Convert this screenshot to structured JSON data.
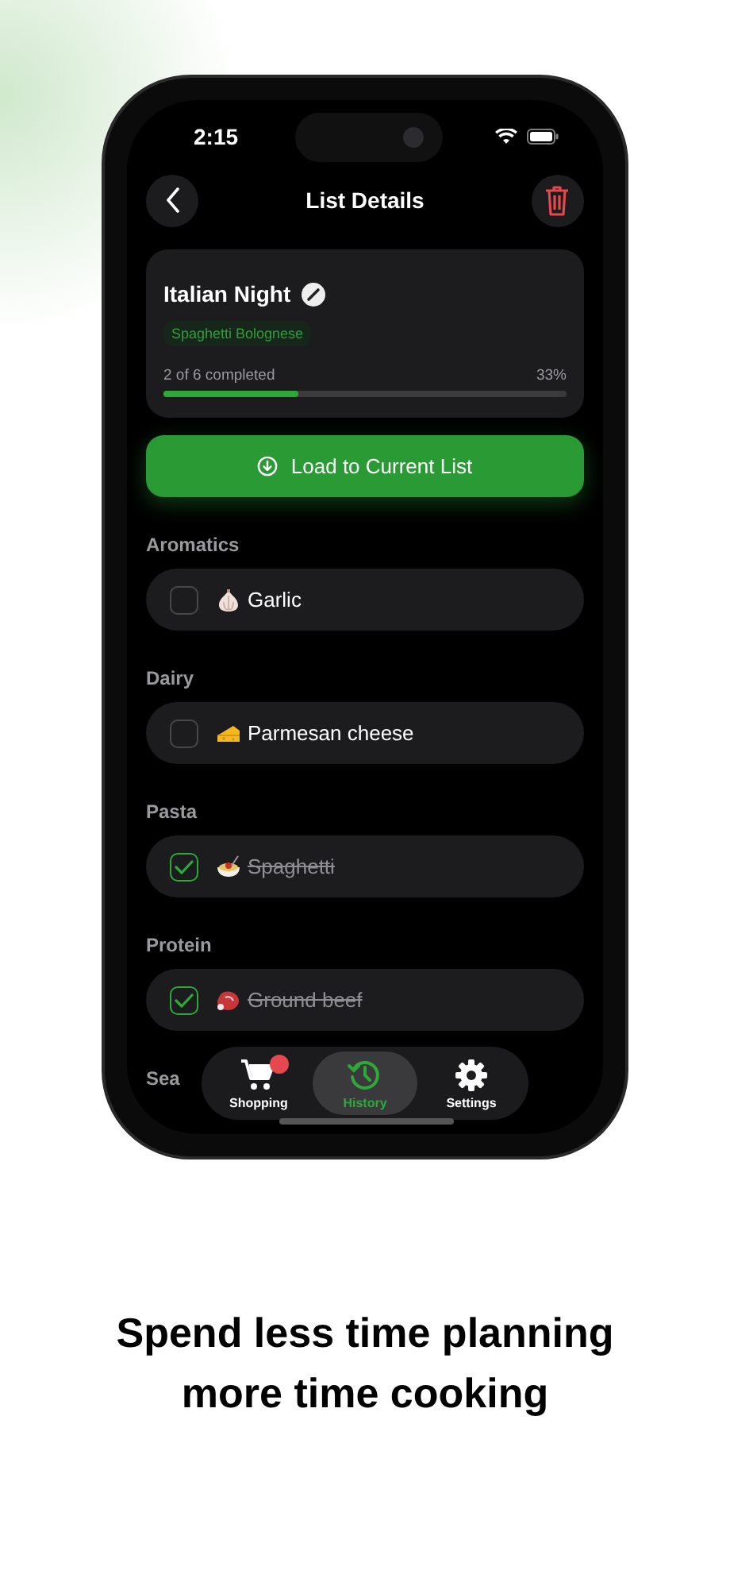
{
  "status_bar": {
    "time": "2:15"
  },
  "header": {
    "title": "List Details"
  },
  "list_card": {
    "title": "Italian Night",
    "tag": "Spaghetti Bolognese",
    "progress_text": "2 of 6 completed",
    "percent": "33%",
    "level": 0.333
  },
  "load_button": {
    "label": "Load to Current List"
  },
  "sections": [
    {
      "category": "Aromatics",
      "items": [
        {
          "name": "Garlic",
          "checked": false
        }
      ]
    },
    {
      "category": "Dairy",
      "items": [
        {
          "name": "Parmesan cheese",
          "checked": false
        }
      ]
    },
    {
      "category": "Pasta",
      "items": [
        {
          "name": "Spaghetti",
          "checked": true
        }
      ]
    },
    {
      "category": "Protein",
      "items": [
        {
          "name": "Ground beef",
          "checked": true
        }
      ]
    },
    {
      "category": "Sea"
    }
  ],
  "tab_bar": [
    {
      "label": "Shopping",
      "selected": false,
      "badge": true
    },
    {
      "label": "History",
      "selected": true,
      "badge": false
    },
    {
      "label": "Settings",
      "selected": false,
      "badge": false
    }
  ],
  "caption": {
    "lines": [
      "Spend less time planning",
      "more time cooking"
    ]
  }
}
